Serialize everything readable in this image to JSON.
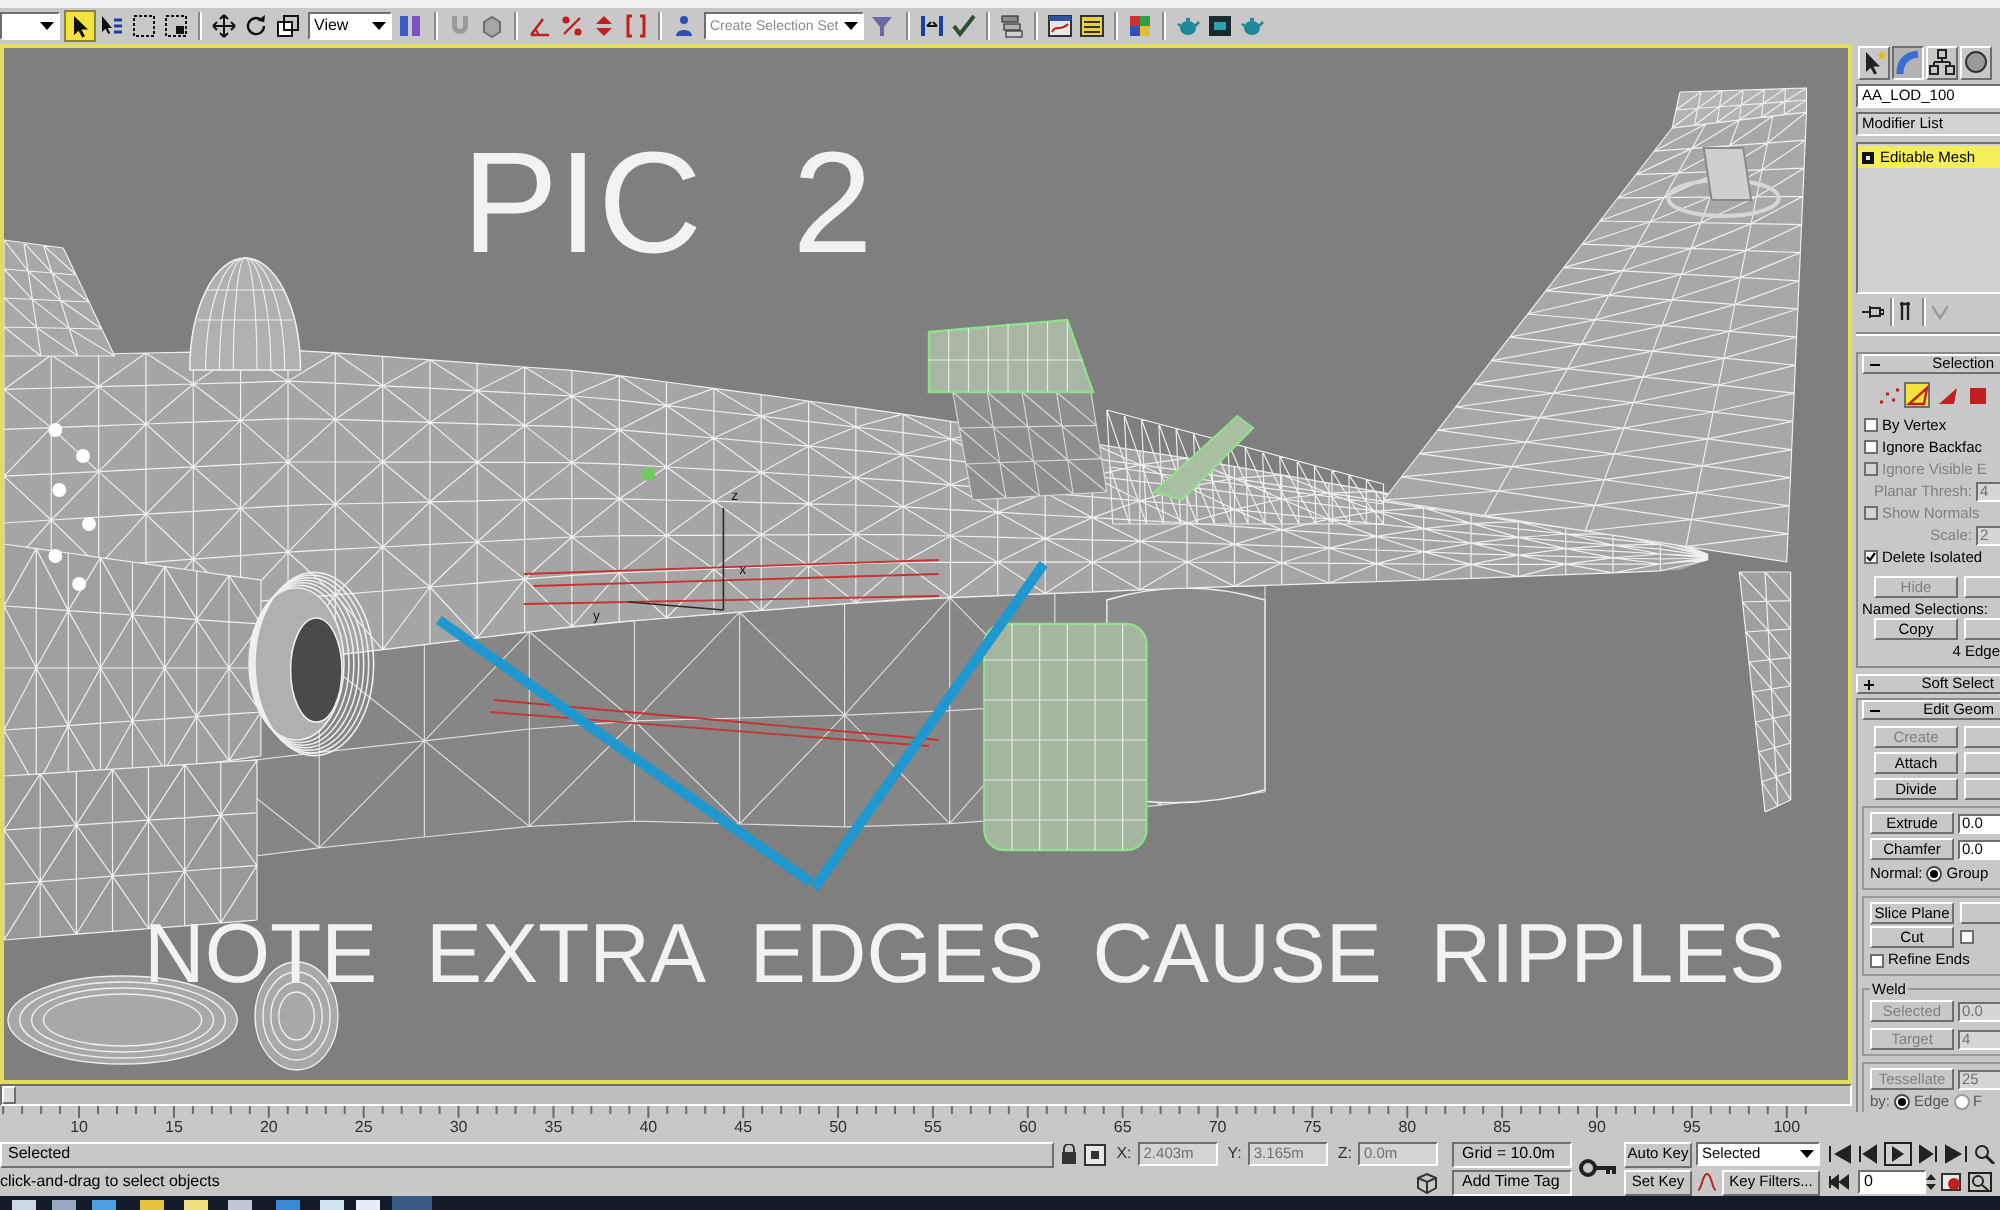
{
  "toolbar": {
    "tools": [
      {
        "selected": true
      },
      {
        "selected": false
      },
      {
        "selected": false
      },
      {
        "selected": false
      }
    ],
    "reference_coordinate": "View",
    "selection_set": {
      "placeholder": "Create Selection Set"
    }
  },
  "viewport": {
    "heading": "PIC 2",
    "caption": "NOTE EXTRA EDGES CAUSE RIPPLES",
    "gizmo_axes": [
      "z",
      "x",
      "y"
    ]
  },
  "command_panel": {
    "tabs": [
      {
        "selected": false
      },
      {
        "selected": true
      },
      {
        "selected": false
      },
      {
        "selected": false
      }
    ],
    "object_name": "AA_LOD_100",
    "modifier_list": "Modifier List",
    "modifier_stack": [
      {
        "label": "Editable Mesh",
        "selected": true
      }
    ],
    "selection": {
      "title": "Selection",
      "expanded": true,
      "levels": [
        {
          "selected": false
        },
        {
          "selected": true
        },
        {
          "selected": false
        },
        {
          "selected": false
        }
      ],
      "options": [
        {
          "kind": "checkbox",
          "label": "By Vertex",
          "checked": false,
          "disabled": false
        },
        {
          "kind": "checkbox",
          "label": "Ignore Backfac",
          "checked": false,
          "disabled": false
        },
        {
          "kind": "checkbox",
          "label": "Ignore Visible E",
          "checked": false,
          "disabled": true
        },
        {
          "kind": "spinner",
          "label": "Planar Thresh:",
          "value": "4",
          "disabled": true
        },
        {
          "kind": "checkbox",
          "label": "Show Normals",
          "checked": false,
          "disabled": true
        },
        {
          "kind": "spinner",
          "label": "Scale:",
          "value": "2",
          "disabled": true
        },
        {
          "kind": "checkbox",
          "label": "Delete Isolated",
          "checked": true,
          "disabled": false
        }
      ],
      "hide": {
        "label": "Hide",
        "disabled": true
      },
      "named_selections": "Named Selections:",
      "copy": {
        "label": "Copy",
        "disabled": false
      },
      "status": "4 Edge"
    },
    "soft_selection": {
      "title": "Soft Select",
      "expanded": false
    },
    "edit_geometry": {
      "title": "Edit Geom",
      "expanded": true,
      "buttons": [
        {
          "label": "Create",
          "disabled": true
        },
        {
          "label": "Attach",
          "disabled": false
        },
        {
          "label": "Divide",
          "disabled": false
        }
      ],
      "extrude": {
        "label": "Extrude",
        "value": "0.0"
      },
      "chamfer": {
        "label": "Chamfer",
        "value": "0.0"
      },
      "normal": {
        "label": "Normal:",
        "options": [
          {
            "label": "Group",
            "selected": true
          }
        ]
      },
      "slice_plane": "Slice Plane",
      "cut": {
        "label": "Cut"
      },
      "split": {
        "checked": false
      },
      "refine_ends": {
        "label": "Refine Ends",
        "checked": false
      },
      "weld": {
        "title": "Weld",
        "buttons": [
          {
            "label": "Selected",
            "value": "0.0",
            "disabled": true
          },
          {
            "label": "Target",
            "value": "4",
            "disabled": true
          }
        ]
      },
      "tessellate": {
        "label": "Tessellate",
        "value": "25",
        "disabled": true,
        "by_label": "by:",
        "options": [
          {
            "label": "Edge",
            "selected": true
          },
          {
            "label": "F",
            "selected": false
          }
        ]
      }
    }
  },
  "time_slider": {
    "level": 0
  },
  "timeline": {
    "labels": [
      "10",
      "15",
      "20",
      "25",
      "30",
      "35",
      "40",
      "45",
      "50",
      "55",
      "60",
      "65",
      "70",
      "75",
      "80",
      "85",
      "90",
      "95",
      "100"
    ]
  },
  "status_bar": {
    "selection": "Selected",
    "coordinates": [
      {
        "label": "X:",
        "value": "2.403m",
        "disabled": true
      },
      {
        "label": "Y:",
        "value": "3.165m",
        "disabled": true
      },
      {
        "label": "Z:",
        "value": "0.0m",
        "disabled": true
      }
    ],
    "grid": "Grid = 10.0m",
    "prompt": "click-and-drag to select objects",
    "time_tag": "Add Time Tag"
  },
  "animation_controls": {
    "auto_key": {
      "label": "Auto Key",
      "on": false
    },
    "key_set": "Selected",
    "set_key": "Set Key",
    "key_filters": "Key Filters...",
    "frame": "0"
  }
}
